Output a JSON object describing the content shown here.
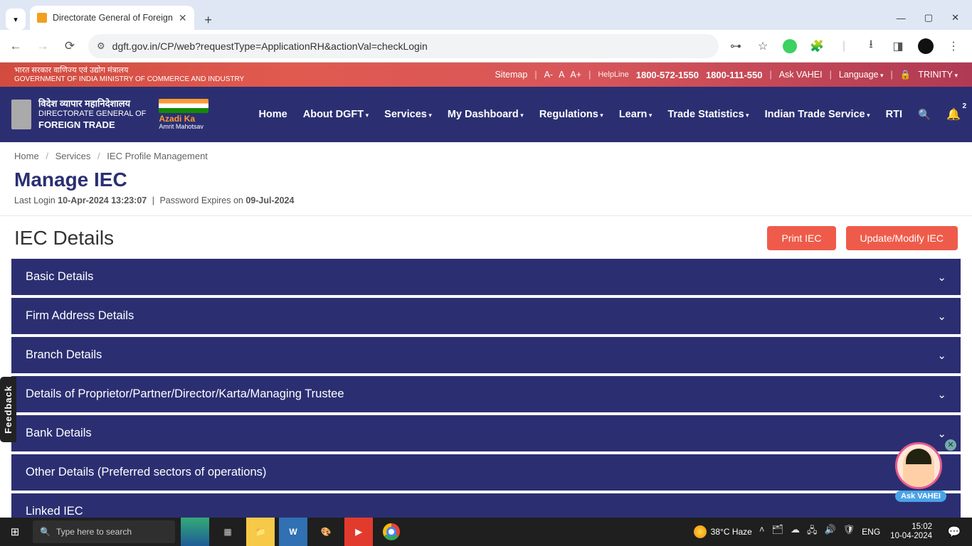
{
  "browser": {
    "tab_title": "Directorate General of Foreign ",
    "url": "dgft.gov.in/CP/web?requestType=ApplicationRH&actionVal=checkLogin"
  },
  "gov_bar": {
    "hindi_top": "भारत सरकार   वाणिज्य एवं उद्योग मंत्रालय",
    "eng_bottom": "GOVERNMENT OF INDIA   MINISTRY OF COMMERCE AND INDUSTRY",
    "sitemap": "Sitemap",
    "a_minus": "A-",
    "a_norm": "A",
    "a_plus": "A+",
    "helpline": "HelpLine",
    "phone1": "1800-572-1550",
    "phone2": "1800-111-550",
    "ask_vahei": "Ask VAHEI",
    "language": "Language",
    "user": "TRINITY"
  },
  "brand": {
    "hindi": "विदेश व्यापार महानिदेशालय",
    "l2": "DIRECTORATE GENERAL OF",
    "l3": "FOREIGN TRADE",
    "azadi1": "Azadi Ka",
    "azadi2": "Amrit Mahotsav"
  },
  "nav": {
    "items": [
      "Home",
      "About DGFT",
      "Services",
      "My Dashboard",
      "Regulations",
      "Learn",
      "Trade Statistics",
      "Indian Trade Service",
      "RTI"
    ],
    "dropdown_flags": [
      false,
      true,
      true,
      true,
      true,
      true,
      true,
      true,
      false
    ],
    "bell_badge": "2"
  },
  "breadcrumb": {
    "c1": "Home",
    "c2": "Services",
    "c3": "IEC Profile Management"
  },
  "page": {
    "title": "Manage IEC",
    "last_login_label": "Last Login ",
    "last_login_value": "10-Apr-2024 13:23:07",
    "pwd_label": "Password Expires on ",
    "pwd_value": "09-Jul-2024"
  },
  "section": {
    "heading": "IEC Details",
    "print_btn": "Print IEC",
    "modify_btn": "Update/Modify IEC"
  },
  "accordion": [
    "Basic Details",
    "Firm Address Details",
    "Branch Details",
    "Details of Proprietor/Partner/Director/Karta/Managing Trustee",
    "Bank Details",
    "Other Details (Preferred sectors of operations)",
    "Linked IEC"
  ],
  "accordion_chevrons": [
    true,
    true,
    true,
    true,
    true,
    false,
    false
  ],
  "feedback": "Feedback",
  "chatbot": {
    "label": "Ask VAHEI"
  },
  "taskbar": {
    "search_placeholder": "Type here to search",
    "weather": "38°C Haze",
    "lang": "ENG",
    "time": "15:02",
    "date": "10-04-2024"
  }
}
